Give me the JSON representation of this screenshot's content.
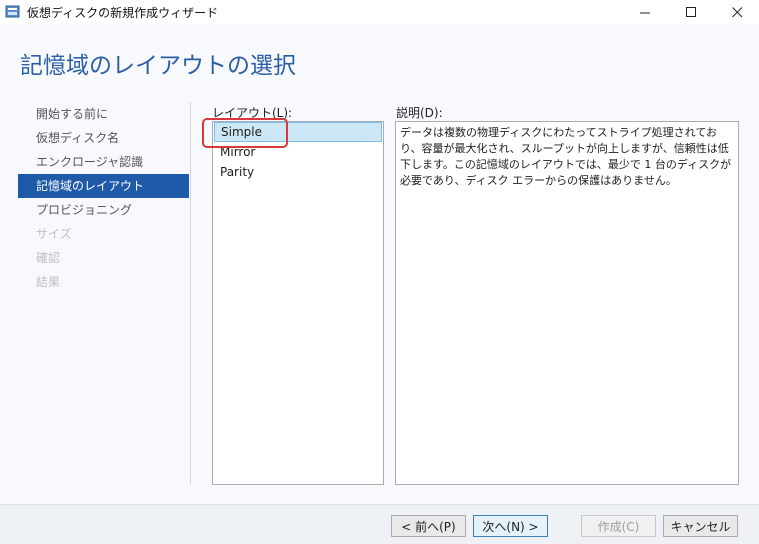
{
  "window": {
    "title": "仮想ディスクの新規作成ウィザード",
    "minimize": "—",
    "maximize": "☐",
    "close": "✕"
  },
  "page": {
    "title": "記憶域のレイアウトの選択"
  },
  "nav": {
    "items": [
      {
        "label": "開始する前に",
        "state": "normal"
      },
      {
        "label": "仮想ディスク名",
        "state": "normal"
      },
      {
        "label": "エンクロージャ認識",
        "state": "normal"
      },
      {
        "label": "記憶域のレイアウト",
        "state": "active"
      },
      {
        "label": "プロビジョニング",
        "state": "normal"
      },
      {
        "label": "サイズ",
        "state": "disabled"
      },
      {
        "label": "確認",
        "state": "disabled"
      },
      {
        "label": "結果",
        "state": "disabled"
      }
    ]
  },
  "layout_list": {
    "label": "レイアウト(L):",
    "items": [
      "Simple",
      "Mirror",
      "Parity"
    ],
    "selected": "Simple"
  },
  "description": {
    "label": "説明(D):",
    "text": "データは複数の物理ディスクにわたってストライプ処理されており、容量が最大化され、スループットが向上しますが、信頼性は低下します。この記憶域のレイアウトでは、最少で 1 台のディスクが必要であり、ディスク エラーからの保護はありません。"
  },
  "buttons": {
    "back": "< 前へ(P)",
    "next": "次へ(N) >",
    "create": "作成(C)",
    "cancel": "キャンセル"
  },
  "colors": {
    "accent": "#1e5aa8",
    "title": "#2b5fa6",
    "selection": "#cce8f6",
    "highlight": "#d9383a"
  }
}
